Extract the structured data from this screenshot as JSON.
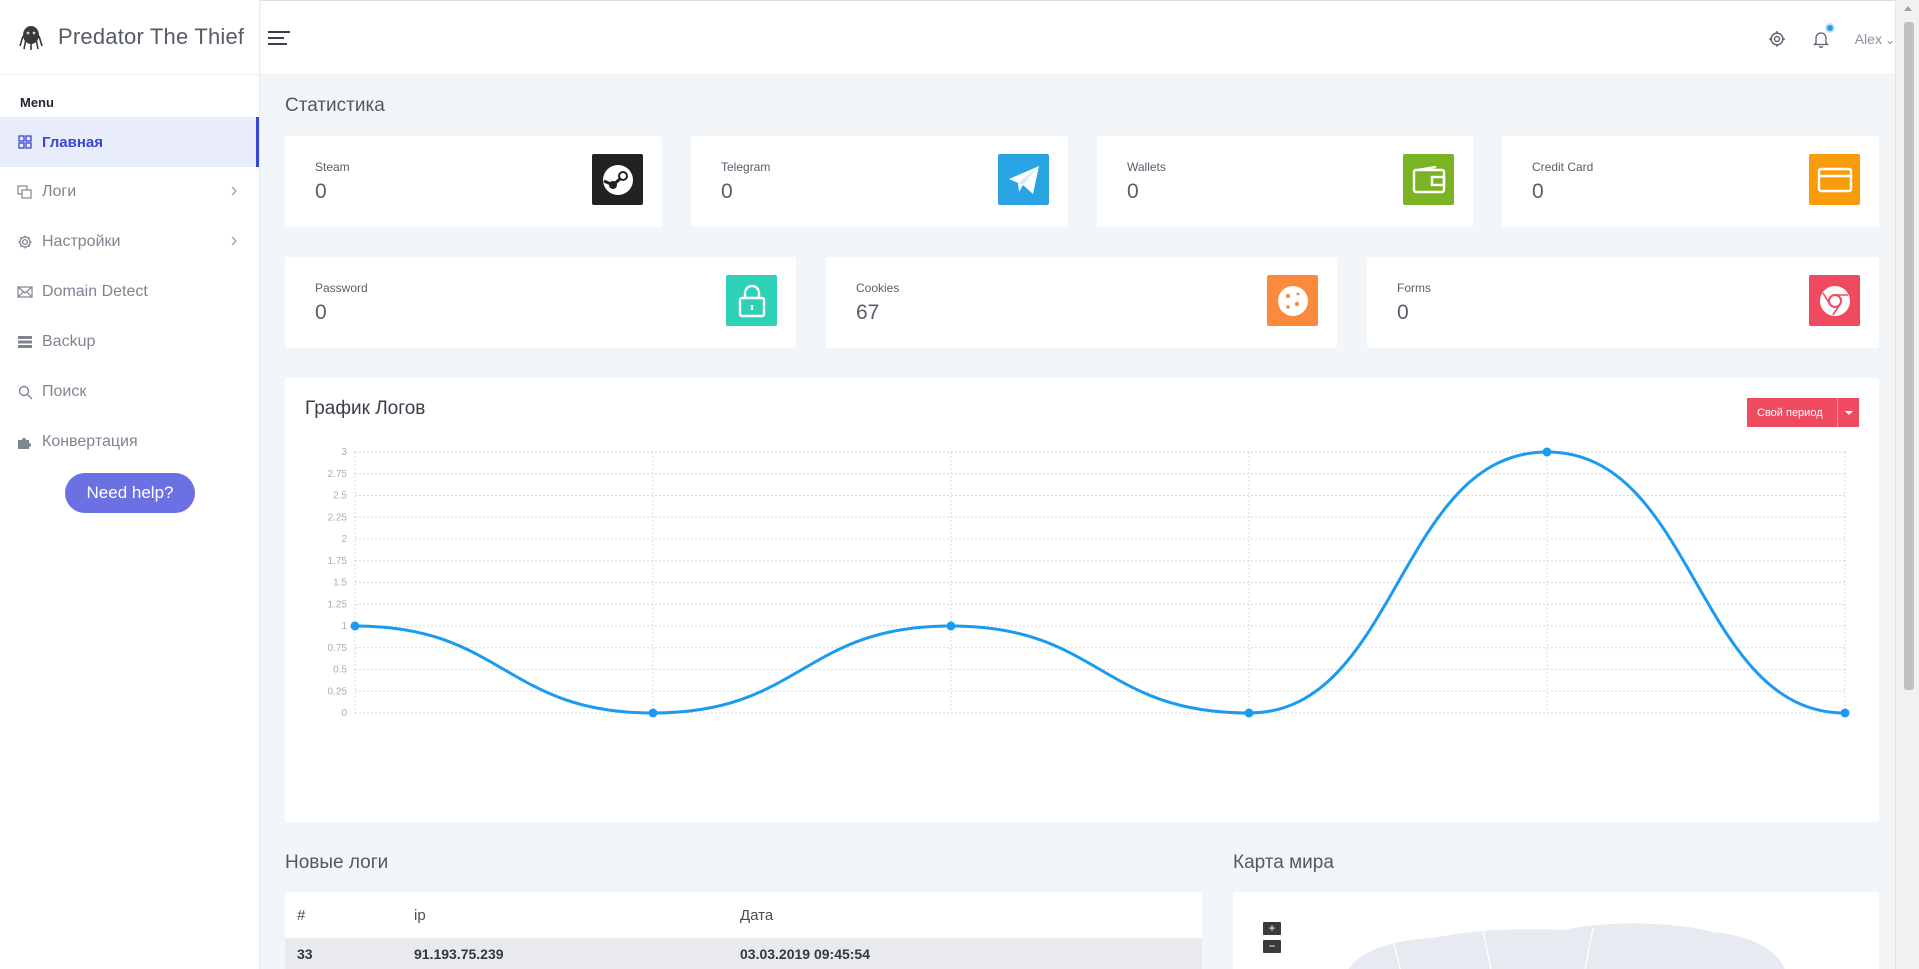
{
  "app": {
    "title": "Predator The Thief"
  },
  "sidebar": {
    "menu_title": "Menu",
    "items": [
      {
        "label": "Главная",
        "icon": "grid-icon",
        "active": true
      },
      {
        "label": "Логи",
        "icon": "copy-icon",
        "has_submenu": true
      },
      {
        "label": "Настройки",
        "icon": "gear-icon",
        "has_submenu": true
      },
      {
        "label": "Domain Detect",
        "icon": "mail-icon"
      },
      {
        "label": "Backup",
        "icon": "server-icon"
      },
      {
        "label": "Поиск",
        "icon": "search-icon"
      },
      {
        "label": "Конвертация",
        "icon": "puzzle-icon"
      }
    ],
    "help_button": "Need help?"
  },
  "topbar": {
    "user": "Alex"
  },
  "stats": {
    "title": "Статистика",
    "cards": [
      {
        "label": "Steam",
        "value": "0",
        "icon": "steam-icon",
        "color": "#222222"
      },
      {
        "label": "Telegram",
        "value": "0",
        "icon": "telegram-icon",
        "color": "#2aa3e4"
      },
      {
        "label": "Wallets",
        "value": "0",
        "icon": "wallet-icon",
        "color": "#7ab422"
      },
      {
        "label": "Credit Card",
        "value": "0",
        "icon": "credit-card-icon",
        "color": "#f99b0b"
      },
      {
        "label": "Password",
        "value": "0",
        "icon": "lock-icon",
        "color": "#2ed1b8"
      },
      {
        "label": "Cookies",
        "value": "67",
        "icon": "cookie-icon",
        "color": "#fb8a3c"
      },
      {
        "label": "Forms",
        "value": "0",
        "icon": "chrome-icon",
        "color": "#f04a61"
      }
    ]
  },
  "chart": {
    "title": "График Логов",
    "period_button": "Свой период"
  },
  "chart_data": {
    "type": "line",
    "title": "График Логов",
    "x_points": 6,
    "values": [
      1,
      0,
      1,
      0,
      3,
      0
    ],
    "ylim": [
      0,
      3
    ],
    "y_ticks": [
      "0",
      "0.25",
      "0.5",
      "0.75",
      "1",
      "1.25",
      "1.5",
      "1.75",
      "2",
      "2.25",
      "2.5",
      "2.75",
      "3"
    ],
    "smooth": true,
    "grid": true,
    "line_color": "#1a9bef"
  },
  "new_logs": {
    "title": "Новые логи",
    "columns": [
      "#",
      "ip",
      "Дата"
    ],
    "rows": [
      {
        "num": "33",
        "ip": "91.193.75.239",
        "date": "03.03.2019 09:45:54"
      }
    ]
  },
  "world_map": {
    "title": "Карта мира",
    "zoom_in": "+",
    "zoom_out": "−"
  }
}
